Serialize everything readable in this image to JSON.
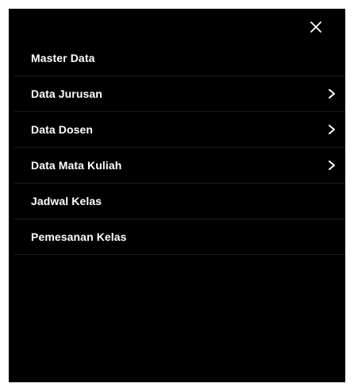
{
  "close_icon": "close-icon",
  "menu": {
    "items": [
      {
        "label": "Master Data",
        "has_submenu": false
      },
      {
        "label": "Data Jurusan",
        "has_submenu": true,
        "icon": "chevron-right-icon"
      },
      {
        "label": "Data Dosen",
        "has_submenu": true,
        "icon": "chevron-right-icon"
      },
      {
        "label": "Data Mata Kuliah",
        "has_submenu": true,
        "icon": "chevron-right-icon"
      },
      {
        "label": "Jadwal Kelas",
        "has_submenu": false
      },
      {
        "label": "Pemesanan Kelas",
        "has_submenu": false
      }
    ]
  },
  "colors": {
    "background": "#000000",
    "text": "#ffffff",
    "divider": "#1c1c1c"
  }
}
